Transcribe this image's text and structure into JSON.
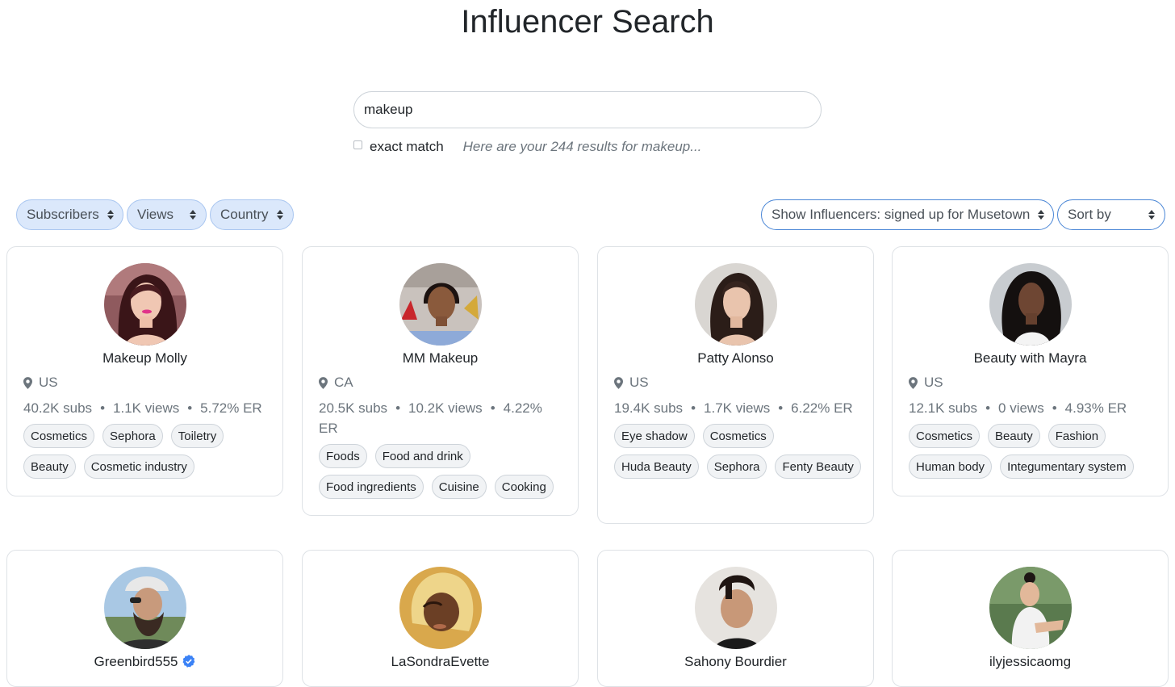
{
  "page": {
    "title": "Influencer Search"
  },
  "search": {
    "value": "makeup",
    "exact_label": "exact match",
    "results_text": "Here are your 244 results for makeup..."
  },
  "filters": {
    "subscribers": "Subscribers",
    "views": "Views",
    "country": "Country",
    "show": "Show Influencers: signed up for Musetown",
    "sort": "Sort by"
  },
  "colors": {
    "accent": "#4a86d6",
    "pill_bg": "#dbe8fb",
    "verified": "#3b82f6"
  },
  "cards": [
    {
      "name": "Makeup Molly",
      "location": "US",
      "subs": "40.2K subs",
      "views": "1.1K views",
      "er": "5.72% ER",
      "tags": [
        "Cosmetics",
        "Sephora",
        "Toiletry",
        "Beauty",
        "Cosmetic industry"
      ]
    },
    {
      "name": "MM Makeup",
      "location": "CA",
      "subs": "20.5K subs",
      "views": "10.2K views",
      "er": "4.22% ER",
      "tags": [
        "Foods",
        "Food and drink",
        "Food ingredients",
        "Cuisine",
        "Cooking"
      ]
    },
    {
      "name": "Patty Alonso",
      "location": "US",
      "subs": "19.4K subs",
      "views": "1.7K views",
      "er": "6.22% ER",
      "tags": [
        "Eye shadow",
        "Cosmetics",
        "Huda Beauty",
        "Sephora",
        "Fenty Beauty"
      ]
    },
    {
      "name": "Beauty with Mayra",
      "location": "US",
      "subs": "12.1K subs",
      "views": "0 views",
      "er": "4.93% ER",
      "tags": [
        "Cosmetics",
        "Beauty",
        "Fashion",
        "Human body",
        "Integumentary system"
      ]
    },
    {
      "name": "Greenbird555",
      "verified": true
    },
    {
      "name": "LaSondraEvette"
    },
    {
      "name": "Sahony Bourdier"
    },
    {
      "name": "ilyjessicaomg"
    }
  ]
}
